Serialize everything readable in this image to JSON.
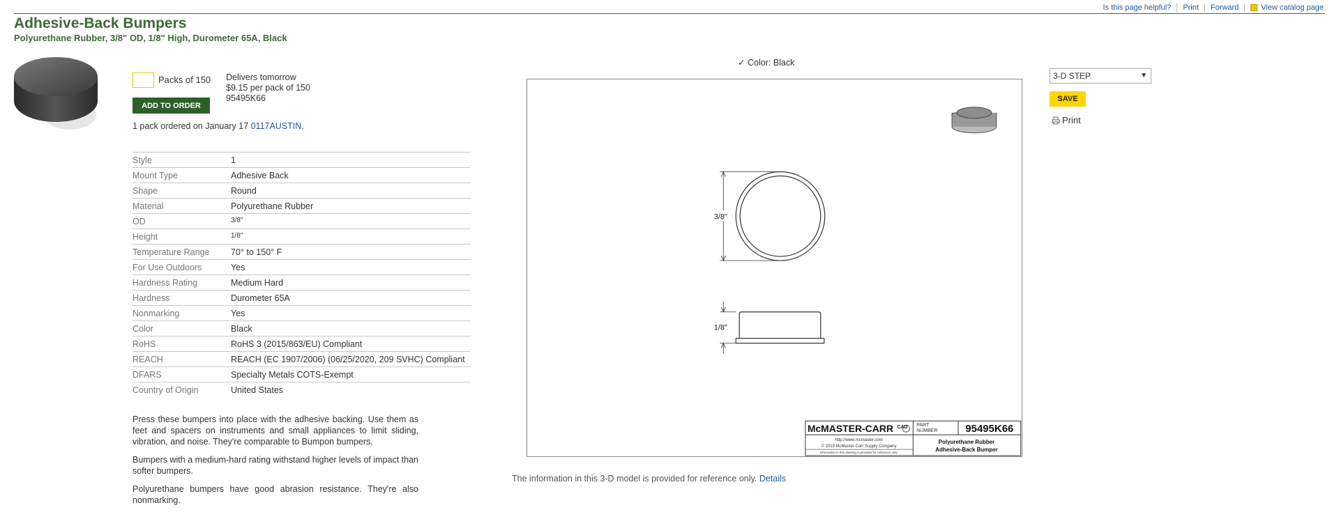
{
  "header": {
    "links": [
      "Is this page helpful?",
      "Print",
      "Forward",
      "View catalog page"
    ],
    "title": "Adhesive-Back Bumpers",
    "subtitle": "Polyurethane Rubber, 3/8\" OD, 1/8\" High, Durometer 65A, Black"
  },
  "order": {
    "quantity_value": "",
    "pack_label": "Packs of 150",
    "delivery": "Delivers tomorrow",
    "price": "$9.15 per pack of 150",
    "part_number": "95495K66",
    "add_button": "ADD TO ORDER",
    "history_text": "1 pack ordered on January 17",
    "history_link": "0117AUSTIN",
    "history_end": "."
  },
  "specs": [
    {
      "key": "Style",
      "value": "1"
    },
    {
      "key": "Mount Type",
      "value": "Adhesive Back"
    },
    {
      "key": "Shape",
      "value": "Round"
    },
    {
      "key": "Material",
      "value": "Polyurethane Rubber"
    },
    {
      "key": "OD",
      "value": "3/8\""
    },
    {
      "key": "Height",
      "value": "1/8\""
    },
    {
      "key": "Temperature Range",
      "value": "70° to 150° F"
    },
    {
      "key": "For Use Outdoors",
      "value": "Yes"
    },
    {
      "key": "Hardness Rating",
      "value": "Medium Hard"
    },
    {
      "key": "Hardness",
      "value": "Durometer 65A"
    },
    {
      "key": "Nonmarking",
      "value": "Yes"
    },
    {
      "key": "Color",
      "value": "Black"
    },
    {
      "key": "RoHS",
      "value": "RoHS 3 (2015/863/EU) Compliant"
    },
    {
      "key": "REACH",
      "value": "REACH (EC 1907/2006) (06/25/2020, 209 SVHC) Compliant"
    },
    {
      "key": "DFARS",
      "value": "Specialty Metals COTS-Exempt"
    },
    {
      "key": "Country of Origin",
      "value": "United States"
    }
  ],
  "description": [
    "Press these bumpers into place with the adhesive backing. Use them as feet and spacers on instruments and small appliances to limit sliding, vibration, and noise. They're comparable to Bumpon bumpers.",
    "Bumpers with a medium-hard rating withstand higher levels of impact than softer bumpers.",
    "Polyurethane bumpers have good abrasion resistance. They're also nonmarking."
  ],
  "drawing": {
    "color_label": "Color: Black",
    "dim_od": "3/8\"",
    "dim_height": "1/8\"",
    "brand": "McMASTER-CARR",
    "cad": "CAD",
    "part_label_1": "PART",
    "part_label_2": "NUMBER",
    "part_number": "95495K66",
    "url": "http://www.mcmaster.com",
    "copyright": "© 2019 McMaster-Carr Supply Company",
    "disclaimer": "Information in this drawing is provided for reference only.",
    "name_line1": "Polyurethane Rubber",
    "name_line2": "Adhesive-Back Bumper",
    "info_text": "The information in this 3-D model is provided for reference only.",
    "info_link": "Details"
  },
  "cad_panel": {
    "format_selected": "3-D STEP",
    "save_label": "SAVE",
    "print_label": "Print"
  },
  "colors": {
    "brand_green": "#3b6b34",
    "button_green": "#2e5e2a",
    "link_blue": "#1f5a9e",
    "save_yellow": "#ffd500"
  }
}
